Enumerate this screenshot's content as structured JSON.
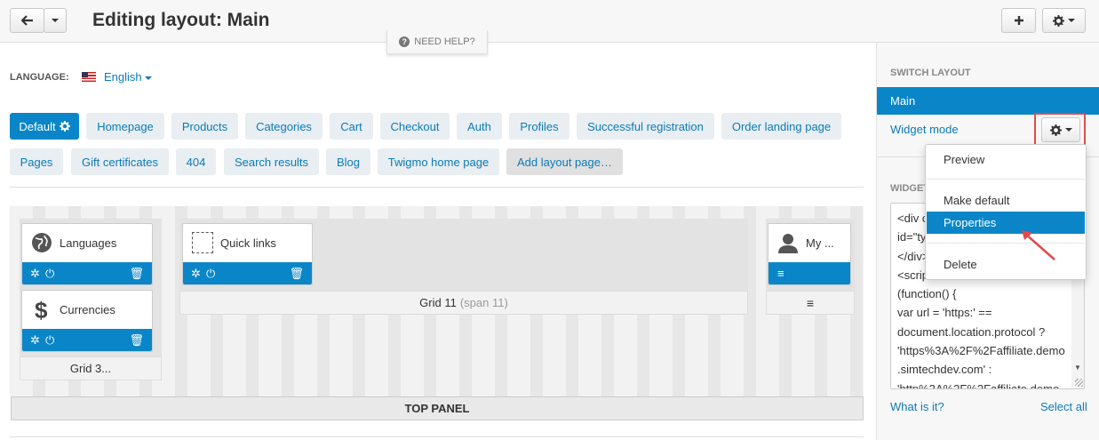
{
  "header": {
    "title": "Editing layout: Main",
    "help_label": "NEED HELP?"
  },
  "language": {
    "label": "LANGUAGE:",
    "value": "English"
  },
  "tabs": [
    {
      "label": "Default",
      "active": true
    },
    {
      "label": "Homepage"
    },
    {
      "label": "Products"
    },
    {
      "label": "Categories"
    },
    {
      "label": "Cart"
    },
    {
      "label": "Checkout"
    },
    {
      "label": "Auth"
    },
    {
      "label": "Profiles"
    },
    {
      "label": "Successful registration"
    },
    {
      "label": "Order landing page"
    },
    {
      "label": "Pages"
    },
    {
      "label": "Gift certificates"
    },
    {
      "label": "404"
    },
    {
      "label": "Search results"
    },
    {
      "label": "Blog"
    },
    {
      "label": "Twigmo home page"
    },
    {
      "label": "Add layout page…"
    }
  ],
  "grids": {
    "grid3": {
      "title": "Grid 3..."
    },
    "grid11": {
      "title": "Grid 11",
      "span": "(span 11)"
    }
  },
  "widgets": {
    "languages": "Languages",
    "currencies": "Currencies",
    "quick_links": "Quick links",
    "my_account": "My ..."
  },
  "top_panel": "TOP PANEL",
  "sidebar": {
    "switch_title": "SWITCH LAYOUT",
    "main_item": "Main",
    "widget_mode": "Widget mode",
    "code_label": "WIDGET",
    "code_lines": [
      "<div c",
      "id=\"ty",
      "</div>",
      "<scrip",
      "(function() {",
      "var url = 'https:' ==",
      "document.location.protocol ?",
      "'https%3A%2F%2Faffiliate.demo",
      ".simtechdev.com' :",
      "'http%3A%2F%2Faffiliate.demo."
    ],
    "what_is_it": "What is it?",
    "select_all": "Select all"
  },
  "dropdown": {
    "preview": "Preview",
    "make_default": "Make default",
    "properties": "Properties",
    "delete": "Delete"
  },
  "colors": {
    "accent": "#0a86c8",
    "highlight": "#e04b4b"
  }
}
